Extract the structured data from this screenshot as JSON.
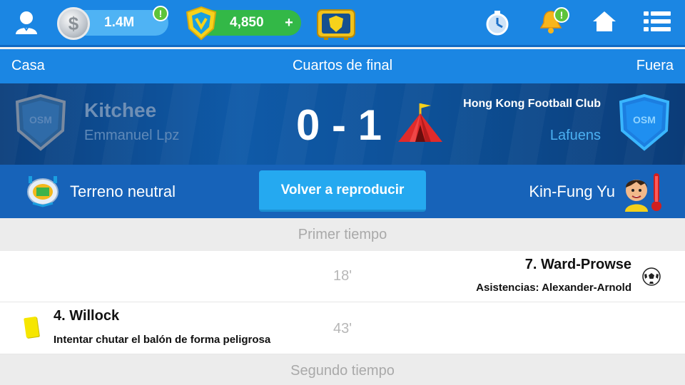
{
  "topbar": {
    "coins": "1.4M",
    "coin_symbol": "$",
    "gems": "4,850",
    "gems_plus": "+",
    "alert_glyph": "!",
    "icons": [
      "user-icon",
      "coin-icon",
      "shield-gem-icon",
      "tv-icon",
      "timer-icon",
      "bell-icon",
      "home-icon",
      "menu-icon"
    ]
  },
  "nav": {
    "home": "Casa",
    "title": "Cuartos de final",
    "away": "Fuera"
  },
  "match": {
    "home_team": "Kitchee",
    "home_manager": "Emmanuel Lpz",
    "score": "0 - 1",
    "away_team": "Hong Kong Football Club",
    "away_manager": "Lafuens",
    "crest_text": "OSM"
  },
  "info": {
    "venue": "Terreno neutral",
    "replay_button": "Volver a reproducir",
    "referee": "Kin-Fung Yu"
  },
  "timeline": {
    "first_half": "Primer tiempo",
    "second_half": "Segundo tiempo",
    "events": [
      {
        "minute": "18'",
        "side": "away",
        "type": "goal",
        "player": "7. Ward-Prowse",
        "detail": "Asistencias: Alexander-Arnold"
      },
      {
        "minute": "43'",
        "side": "home",
        "type": "yellow-card",
        "player": "4. Willock",
        "detail": "Intentar chutar el balón de forma peligrosa"
      }
    ]
  },
  "colors": {
    "topbar": "#1b86e3",
    "scoreboard": "#0f5aa8",
    "infobar": "#1763b9",
    "replay_button": "#25a9f0",
    "gems_pill": "#33b847",
    "coins_pill": "#4fb3f4"
  }
}
